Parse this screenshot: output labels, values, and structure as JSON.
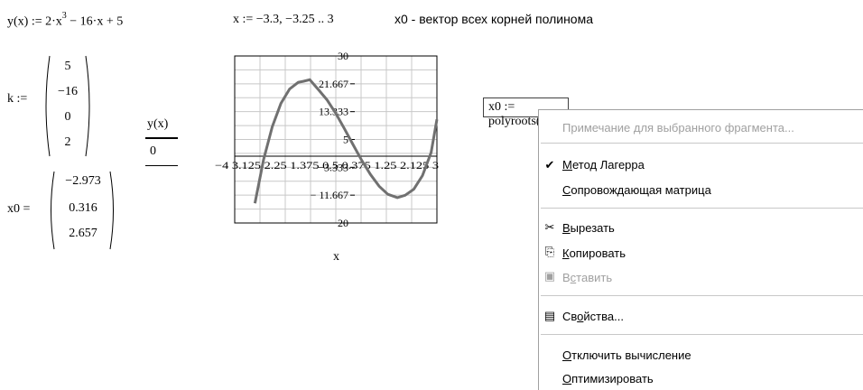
{
  "defs": {
    "y_def_prefix": "y(x) := 2·x",
    "y_def_exp": "3",
    "y_def_suffix": " − 16·x + 5",
    "x_range": "x := −3.3, −3.25 .. 3",
    "x0_comment": "x0 - вектор всех корней полинома"
  },
  "k_matrix": {
    "label": "k :=",
    "values": [
      "5",
      "−16",
      "0",
      "2"
    ]
  },
  "x0_matrix": {
    "label": "x0 =",
    "values": [
      "−2.973",
      "0.316",
      "2.657"
    ]
  },
  "y_table": {
    "header": "y(x)",
    "value": "0"
  },
  "plot": {
    "y_ticks": [
      "30",
      "21.667",
      "13.333",
      "5",
      "−3.333",
      "− 11.667",
      "− 20"
    ],
    "x_tick_text": "−4 3.125 2.25 1.375 0.5 0.375 1.25 2.125 3",
    "x_label": "x"
  },
  "chart_data": {
    "type": "line",
    "title": "",
    "xlabel": "x",
    "ylabel": "",
    "xlim": [
      -4,
      3
    ],
    "ylim": [
      -20,
      30
    ],
    "function": "2·x^3 − 16·x + 5",
    "series": [
      {
        "x": [
          -3.3,
          -3.0,
          -2.7,
          -2.4,
          -2.1,
          -1.8,
          -1.63,
          -1.4,
          -1.1,
          -0.8,
          -0.5,
          -0.2,
          0.1,
          0.4,
          0.7,
          1.0,
          1.3,
          1.63,
          1.9,
          2.2,
          2.5,
          2.8,
          3.0
        ],
        "values": [
          -14.1,
          -1.0,
          8.8,
          15.8,
          20.1,
          22.1,
          22.4,
          22.9,
          19.9,
          16.8,
          12.8,
          8.2,
          3.4,
          -1.3,
          -5.5,
          -9.0,
          -11.4,
          -12.4,
          -11.7,
          -9.9,
          -5.8,
          1.1,
          11.0
        ]
      }
    ]
  },
  "eval": {
    "text": "x0 := polyroots(k)"
  },
  "context_menu": {
    "items": {
      "note": "Примечание для выбранного фрагмента...",
      "laguerre": "Метод Лагерра",
      "companion": "Сопровождающая матрица",
      "cut": "Вырезать",
      "copy": "Копировать",
      "paste": "Вставить",
      "properties": "Свойства...",
      "disable_eval": "Отключить вычисление",
      "optimize": "Оптимизировать"
    },
    "icons": {
      "check": "checkmark-icon",
      "cut": "scissors-icon",
      "copy": "copy-icon",
      "paste": "paste-icon",
      "properties": "properties-icon"
    }
  }
}
